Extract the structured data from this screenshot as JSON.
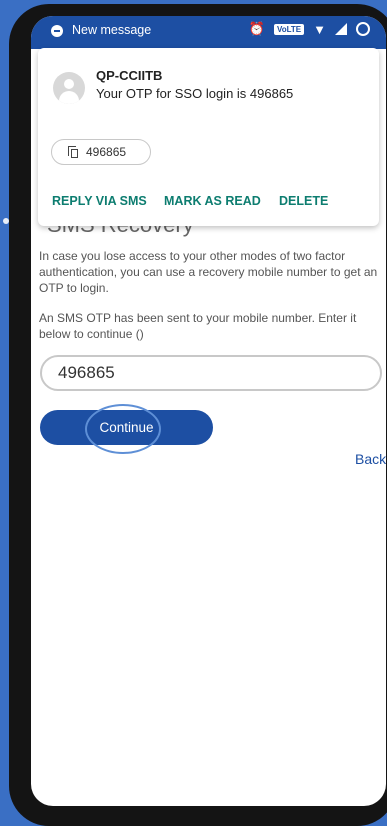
{
  "status_bar": {
    "title": "New message"
  },
  "notification": {
    "sender": "QP-CCIITB",
    "message": "Your OTP for SSO login is 496865",
    "copy_chip": "496865",
    "actions": [
      "REPLY VIA SMS",
      "MARK AS READ",
      "DELETE"
    ]
  },
  "page": {
    "title": "SMS Recovery",
    "description": "In case you lose access to your other modes of two factor authentication, you can use a recovery mobile number to get an OTP to login.",
    "instruction": "An SMS OTP has been sent to your mobile number. Enter it below to continue ()",
    "otp_value": "496865",
    "continue_label": "Continue",
    "back_label": "Back"
  },
  "colors": {
    "primary": "#1d4fa3",
    "action_teal": "#0d7d70",
    "background": "#3a6fc4"
  }
}
